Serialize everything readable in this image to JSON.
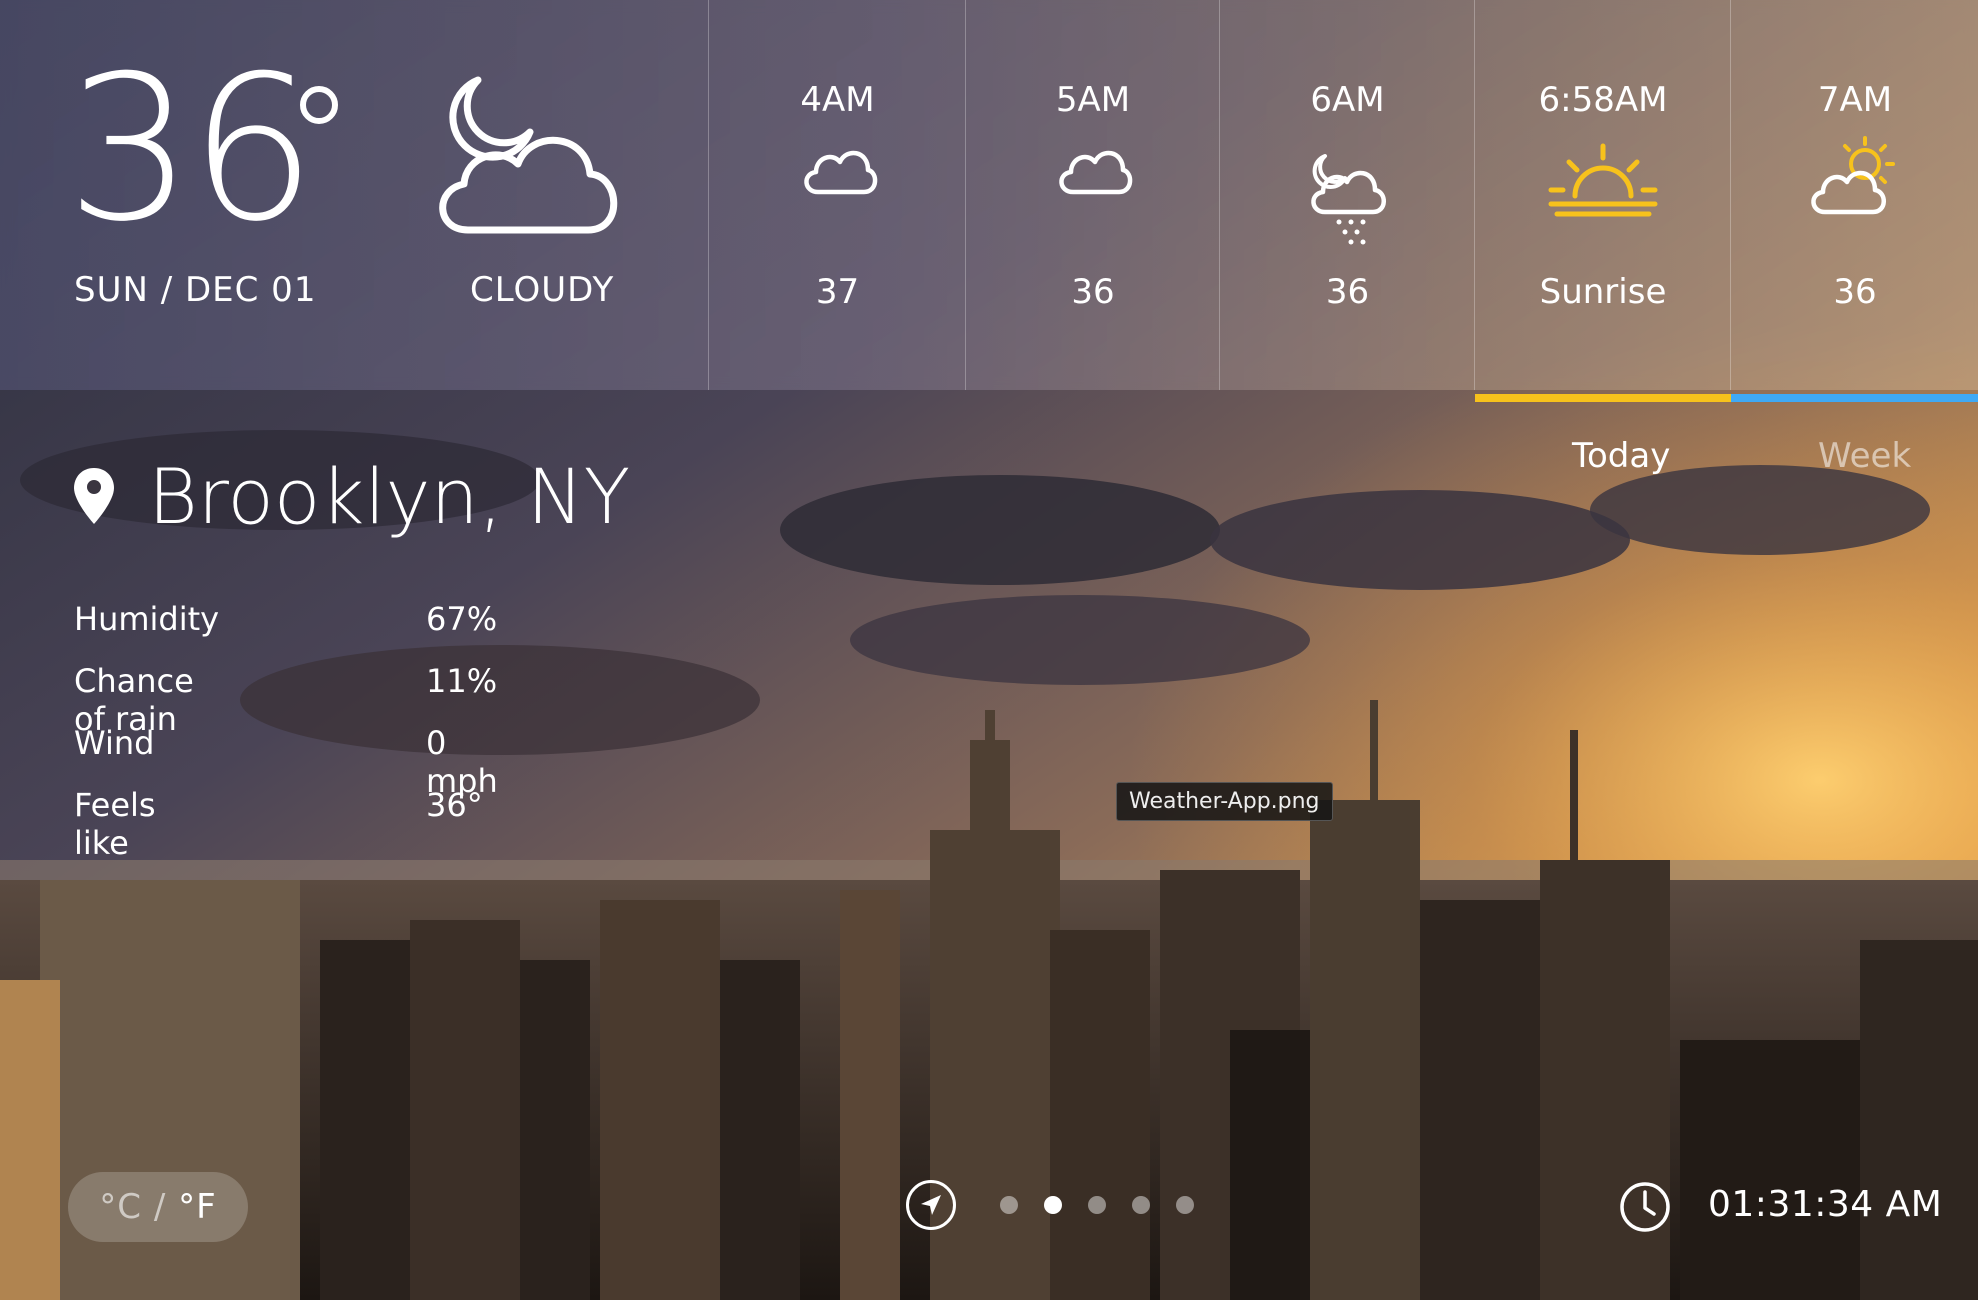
{
  "current": {
    "temperature": "36",
    "date": "SUN / DEC 01",
    "condition": "CLOUDY",
    "condition_icon": "moon-cloud-icon"
  },
  "hourly": [
    {
      "time": "4AM",
      "value": "37",
      "icon": "cloud-icon"
    },
    {
      "time": "5AM",
      "value": "36",
      "icon": "cloud-icon"
    },
    {
      "time": "6AM",
      "value": "36",
      "icon": "moon-cloud-rain-icon"
    },
    {
      "time": "6:58AM",
      "value": "Sunrise",
      "icon": "sunrise-icon",
      "accent": "#F7C21C"
    },
    {
      "time": "7AM",
      "value": "36",
      "icon": "sun-cloud-icon",
      "accent": "#3FA9F5"
    }
  ],
  "location": {
    "name": "Brooklyn, NY"
  },
  "stats": [
    {
      "label": "Humidity",
      "value": "67%"
    },
    {
      "label": "Chance of rain",
      "value": "11%"
    },
    {
      "label": "Wind",
      "value": "0 mph"
    },
    {
      "label": "Feels like",
      "value": "36°"
    }
  ],
  "range_tabs": {
    "today": "Today",
    "week": "Week",
    "selected": "Today"
  },
  "tooltip": "Weather-App.png",
  "units": {
    "celsius": "°C",
    "separator": "/",
    "fahrenheit": "°F"
  },
  "pager": {
    "count": 5,
    "active_index": 1
  },
  "clock": {
    "time": "01:31:34 AM"
  },
  "colors": {
    "sunrise_accent": "#F7C21C",
    "next_accent": "#3FA9F5"
  }
}
